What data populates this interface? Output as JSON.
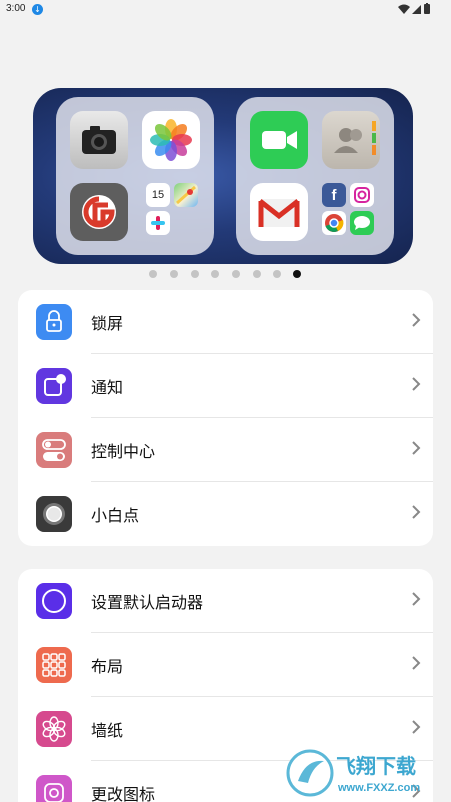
{
  "status_bar": {
    "time": "3:00",
    "icons": [
      "download-icon",
      "wifi-icon",
      "signal-icon",
      "battery-icon"
    ]
  },
  "preview": {
    "folder_left_apps": [
      "camera-icon",
      "photos-icon",
      "avatar-app-icon",
      "calendar-icon",
      "maps-icon",
      "slack-icon"
    ],
    "calendar_day": "15",
    "folder_right_apps": [
      "facetime-icon",
      "contacts-icon",
      "gmail-icon",
      "facebook-icon",
      "instagram-icon",
      "chrome-icon",
      "messages-icon"
    ]
  },
  "pager": {
    "count": 8,
    "active_index": 7
  },
  "group1": [
    {
      "label": "锁屏",
      "icon": "lock-icon",
      "color": "#3d8bf2"
    },
    {
      "label": "通知",
      "icon": "notification-icon",
      "color": "#6137e0"
    },
    {
      "label": "控制中心",
      "icon": "toggle-icon",
      "color": "#d97c7c"
    },
    {
      "label": "小白点",
      "icon": "assistive-touch-icon",
      "color": "#3a3a3a"
    }
  ],
  "group2": [
    {
      "label": "设置默认启动器",
      "icon": "circle-icon",
      "color": "#5a2ee8"
    },
    {
      "label": "布局",
      "icon": "grid-icon",
      "color": "#ee6a4e"
    },
    {
      "label": "墙纸",
      "icon": "flower-icon",
      "color": "#d64a8e"
    },
    {
      "label": "更改图标",
      "icon": "app-icon-change",
      "color": "#cf57c9"
    }
  ],
  "watermark": {
    "brand": "飞翔下载",
    "url": "www.FXXZ.com"
  }
}
